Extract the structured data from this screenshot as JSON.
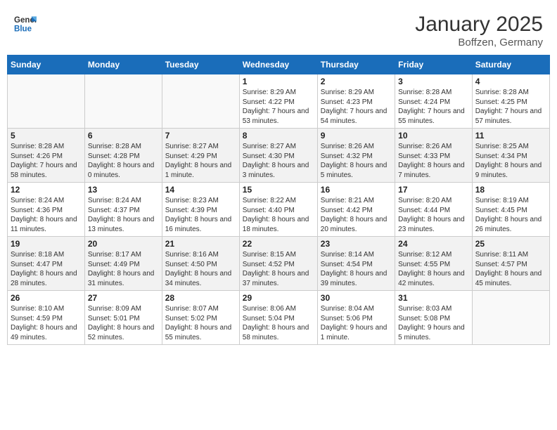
{
  "header": {
    "logo_line1": "General",
    "logo_line2": "Blue",
    "month": "January 2025",
    "location": "Boffzen, Germany"
  },
  "weekdays": [
    "Sunday",
    "Monday",
    "Tuesday",
    "Wednesday",
    "Thursday",
    "Friday",
    "Saturday"
  ],
  "weeks": [
    [
      {
        "day": "",
        "info": ""
      },
      {
        "day": "",
        "info": ""
      },
      {
        "day": "",
        "info": ""
      },
      {
        "day": "1",
        "info": "Sunrise: 8:29 AM\nSunset: 4:22 PM\nDaylight: 7 hours and 53 minutes."
      },
      {
        "day": "2",
        "info": "Sunrise: 8:29 AM\nSunset: 4:23 PM\nDaylight: 7 hours and 54 minutes."
      },
      {
        "day": "3",
        "info": "Sunrise: 8:28 AM\nSunset: 4:24 PM\nDaylight: 7 hours and 55 minutes."
      },
      {
        "day": "4",
        "info": "Sunrise: 8:28 AM\nSunset: 4:25 PM\nDaylight: 7 hours and 57 minutes."
      }
    ],
    [
      {
        "day": "5",
        "info": "Sunrise: 8:28 AM\nSunset: 4:26 PM\nDaylight: 7 hours and 58 minutes."
      },
      {
        "day": "6",
        "info": "Sunrise: 8:28 AM\nSunset: 4:28 PM\nDaylight: 8 hours and 0 minutes."
      },
      {
        "day": "7",
        "info": "Sunrise: 8:27 AM\nSunset: 4:29 PM\nDaylight: 8 hours and 1 minute."
      },
      {
        "day": "8",
        "info": "Sunrise: 8:27 AM\nSunset: 4:30 PM\nDaylight: 8 hours and 3 minutes."
      },
      {
        "day": "9",
        "info": "Sunrise: 8:26 AM\nSunset: 4:32 PM\nDaylight: 8 hours and 5 minutes."
      },
      {
        "day": "10",
        "info": "Sunrise: 8:26 AM\nSunset: 4:33 PM\nDaylight: 8 hours and 7 minutes."
      },
      {
        "day": "11",
        "info": "Sunrise: 8:25 AM\nSunset: 4:34 PM\nDaylight: 8 hours and 9 minutes."
      }
    ],
    [
      {
        "day": "12",
        "info": "Sunrise: 8:24 AM\nSunset: 4:36 PM\nDaylight: 8 hours and 11 minutes."
      },
      {
        "day": "13",
        "info": "Sunrise: 8:24 AM\nSunset: 4:37 PM\nDaylight: 8 hours and 13 minutes."
      },
      {
        "day": "14",
        "info": "Sunrise: 8:23 AM\nSunset: 4:39 PM\nDaylight: 8 hours and 16 minutes."
      },
      {
        "day": "15",
        "info": "Sunrise: 8:22 AM\nSunset: 4:40 PM\nDaylight: 8 hours and 18 minutes."
      },
      {
        "day": "16",
        "info": "Sunrise: 8:21 AM\nSunset: 4:42 PM\nDaylight: 8 hours and 20 minutes."
      },
      {
        "day": "17",
        "info": "Sunrise: 8:20 AM\nSunset: 4:44 PM\nDaylight: 8 hours and 23 minutes."
      },
      {
        "day": "18",
        "info": "Sunrise: 8:19 AM\nSunset: 4:45 PM\nDaylight: 8 hours and 26 minutes."
      }
    ],
    [
      {
        "day": "19",
        "info": "Sunrise: 8:18 AM\nSunset: 4:47 PM\nDaylight: 8 hours and 28 minutes."
      },
      {
        "day": "20",
        "info": "Sunrise: 8:17 AM\nSunset: 4:49 PM\nDaylight: 8 hours and 31 minutes."
      },
      {
        "day": "21",
        "info": "Sunrise: 8:16 AM\nSunset: 4:50 PM\nDaylight: 8 hours and 34 minutes."
      },
      {
        "day": "22",
        "info": "Sunrise: 8:15 AM\nSunset: 4:52 PM\nDaylight: 8 hours and 37 minutes."
      },
      {
        "day": "23",
        "info": "Sunrise: 8:14 AM\nSunset: 4:54 PM\nDaylight: 8 hours and 39 minutes."
      },
      {
        "day": "24",
        "info": "Sunrise: 8:12 AM\nSunset: 4:55 PM\nDaylight: 8 hours and 42 minutes."
      },
      {
        "day": "25",
        "info": "Sunrise: 8:11 AM\nSunset: 4:57 PM\nDaylight: 8 hours and 45 minutes."
      }
    ],
    [
      {
        "day": "26",
        "info": "Sunrise: 8:10 AM\nSunset: 4:59 PM\nDaylight: 8 hours and 49 minutes."
      },
      {
        "day": "27",
        "info": "Sunrise: 8:09 AM\nSunset: 5:01 PM\nDaylight: 8 hours and 52 minutes."
      },
      {
        "day": "28",
        "info": "Sunrise: 8:07 AM\nSunset: 5:02 PM\nDaylight: 8 hours and 55 minutes."
      },
      {
        "day": "29",
        "info": "Sunrise: 8:06 AM\nSunset: 5:04 PM\nDaylight: 8 hours and 58 minutes."
      },
      {
        "day": "30",
        "info": "Sunrise: 8:04 AM\nSunset: 5:06 PM\nDaylight: 9 hours and 1 minute."
      },
      {
        "day": "31",
        "info": "Sunrise: 8:03 AM\nSunset: 5:08 PM\nDaylight: 9 hours and 5 minutes."
      },
      {
        "day": "",
        "info": ""
      }
    ]
  ]
}
